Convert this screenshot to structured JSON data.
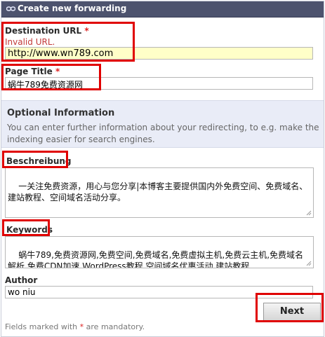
{
  "header": {
    "title": "Create new forwarding"
  },
  "required_mark": "*",
  "destination": {
    "label": "Destination URL",
    "error": "Invalid URL.",
    "value": "http://www.wn789.com"
  },
  "page_title": {
    "label": "Page Title",
    "value": "蜗牛789免费资源网"
  },
  "optional": {
    "title": "Optional Information",
    "description": "You can enter further information about your redirecting, to e.g. make the indexing easier for search engines."
  },
  "beschreibung": {
    "label": "Beschreibung",
    "value": "一关注免费资源，用心与您分享|本博客主要提供国内外免费空间、免费域名、建站教程、空间域名活动分享。"
  },
  "keywords": {
    "label": "Keywords",
    "value": "蜗牛789,免费资源网,免费空间,免费域名,免费虚拟主机,免费云主机,免费域名解析,免费CDN加速,WordPress教程,空间域名优惠活动,建站教程"
  },
  "author": {
    "label": "Author",
    "value": "wo niu"
  },
  "next_button": {
    "label": "Next"
  },
  "footnote": {
    "prefix": "Fields marked with ",
    "mark": "*",
    "suffix": " are mandatory."
  }
}
